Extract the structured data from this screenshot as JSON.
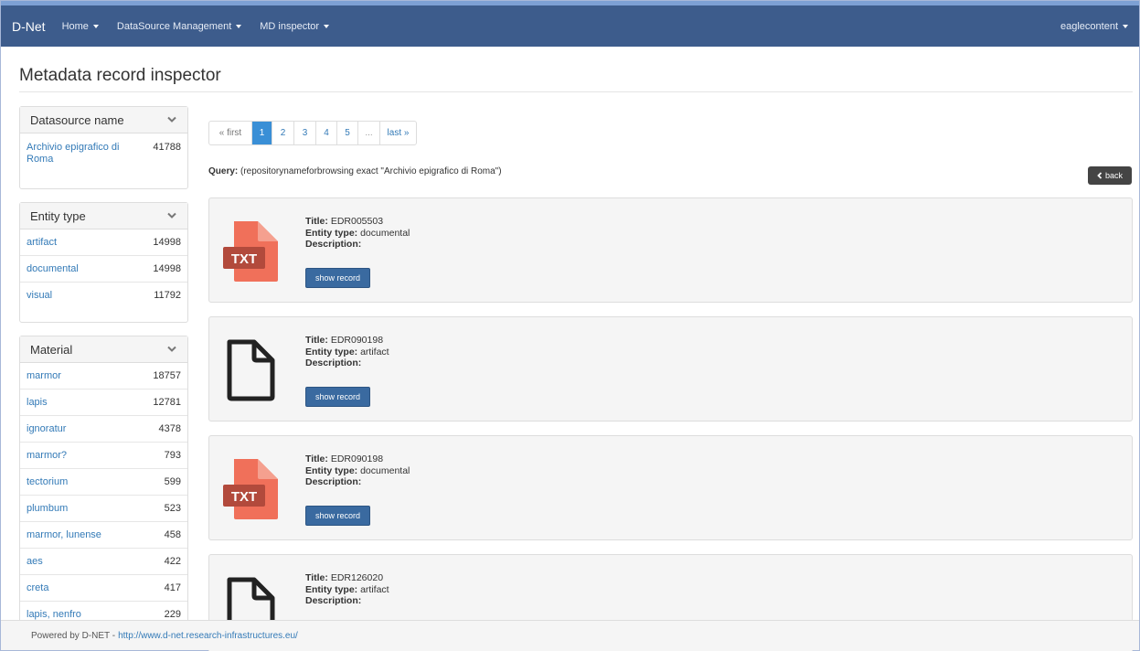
{
  "navbar": {
    "brand": "D-Net",
    "menus": [
      {
        "label": "Home"
      },
      {
        "label": "DataSource Management"
      },
      {
        "label": "MD inspector"
      }
    ],
    "user": "eaglecontent"
  },
  "page": {
    "title": "Metadata record inspector"
  },
  "facets": {
    "datasource": {
      "title": "Datasource name",
      "items": [
        {
          "label": "Archivio epigrafico di Roma",
          "count": "41788"
        }
      ]
    },
    "entity_type": {
      "title": "Entity type",
      "items": [
        {
          "label": "artifact",
          "count": "14998"
        },
        {
          "label": "documental",
          "count": "14998"
        },
        {
          "label": "visual",
          "count": "11792"
        }
      ]
    },
    "material": {
      "title": "Material",
      "items": [
        {
          "label": "marmor",
          "count": "18757"
        },
        {
          "label": "lapis",
          "count": "12781"
        },
        {
          "label": "ignoratur",
          "count": "4378"
        },
        {
          "label": "marmor?",
          "count": "793"
        },
        {
          "label": "tectorium",
          "count": "599"
        },
        {
          "label": "plumbum",
          "count": "523"
        },
        {
          "label": "marmor, lunense",
          "count": "458"
        },
        {
          "label": "aes",
          "count": "422"
        },
        {
          "label": "creta",
          "count": "417"
        },
        {
          "label": "lapis, nenfro",
          "count": "229"
        }
      ]
    }
  },
  "pagination": {
    "first": "« first",
    "pages": [
      "1",
      "2",
      "3",
      "4",
      "5"
    ],
    "active": "1",
    "ellipsis": "...",
    "last": "last »"
  },
  "query": {
    "label": "Query:",
    "text": "(repositorynameforbrowsing exact \"Archivio epigrafico di Roma\")"
  },
  "back_button": "back",
  "record_labels": {
    "title": "Title:",
    "entity_type": "Entity type:",
    "description": "Description:",
    "show": "show record"
  },
  "records": [
    {
      "title": "EDR005503",
      "entity_type": "documental",
      "description": "",
      "icon": "txt-file-icon",
      "badge": "TXT"
    },
    {
      "title": "EDR090198",
      "entity_type": "artifact",
      "description": "",
      "icon": "blank-file-icon"
    },
    {
      "title": "EDR090198",
      "entity_type": "documental",
      "description": "",
      "icon": "txt-file-icon",
      "badge": "TXT"
    },
    {
      "title": "EDR126020",
      "entity_type": "artifact",
      "description": "",
      "icon": "blank-file-icon"
    }
  ],
  "footer": {
    "text": "Powered by D-NET - ",
    "link": "http://www.d-net.research-infrastructures.eu/"
  },
  "colors": {
    "navbar": "#3d5c8c",
    "link": "#337ab7",
    "txt_icon": "#f0705a",
    "txt_badge": "#b24a3c",
    "show_button": "#3a6aa0"
  }
}
